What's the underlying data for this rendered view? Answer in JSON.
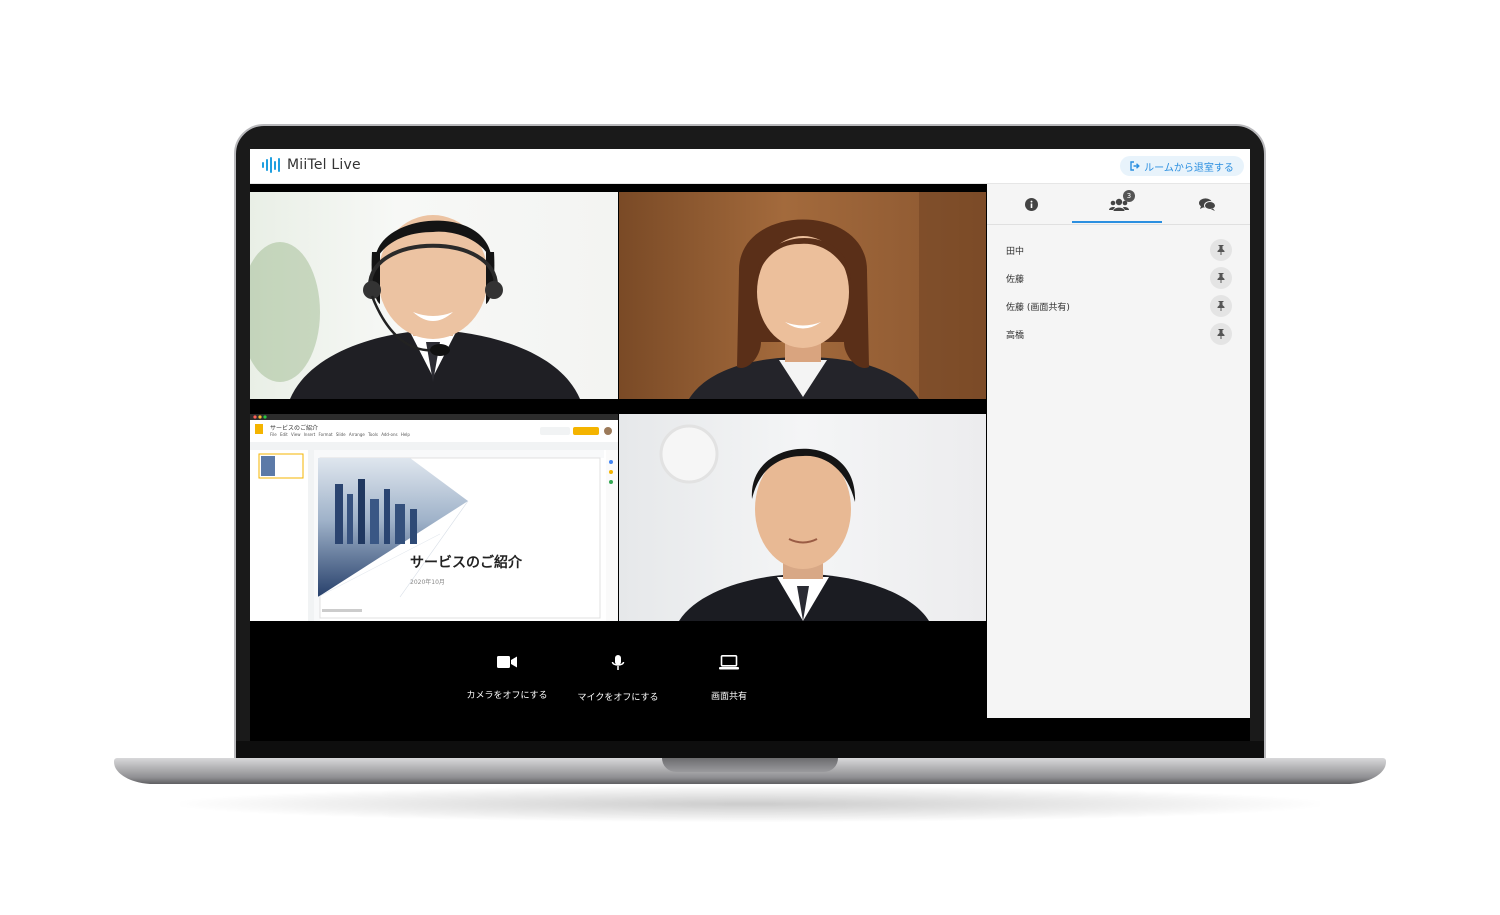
{
  "app": {
    "logo_text": "MiiTel Live",
    "leave_button": "ルームから退室する"
  },
  "slide": {
    "doc_title": "サービスのご紹介",
    "menu": "File Edit View Insert Format Slide Arrange Tools Add-ons Help",
    "title": "サービスのご紹介",
    "date": "2020年10月"
  },
  "controls": {
    "camera": "カメラをオフにする",
    "mic": "マイクをオフにする",
    "share": "画面共有"
  },
  "panel": {
    "tabs": [
      "info",
      "participants",
      "chat"
    ],
    "participant_count": "3",
    "participants": [
      {
        "name": "田中"
      },
      {
        "name": "佐藤"
      },
      {
        "name": "佐藤 (画面共有)"
      },
      {
        "name": "高橋"
      }
    ]
  },
  "colors": {
    "accent": "#2b8fe0",
    "logo": "#1f9fe0"
  },
  "icons": {
    "camera": "video-camera-icon",
    "mic": "microphone-icon",
    "share": "laptop-icon",
    "info": "info-circle-icon",
    "participants": "users-icon",
    "chat": "chat-bubbles-icon",
    "pin": "pin-icon",
    "leave": "sign-out-icon"
  }
}
